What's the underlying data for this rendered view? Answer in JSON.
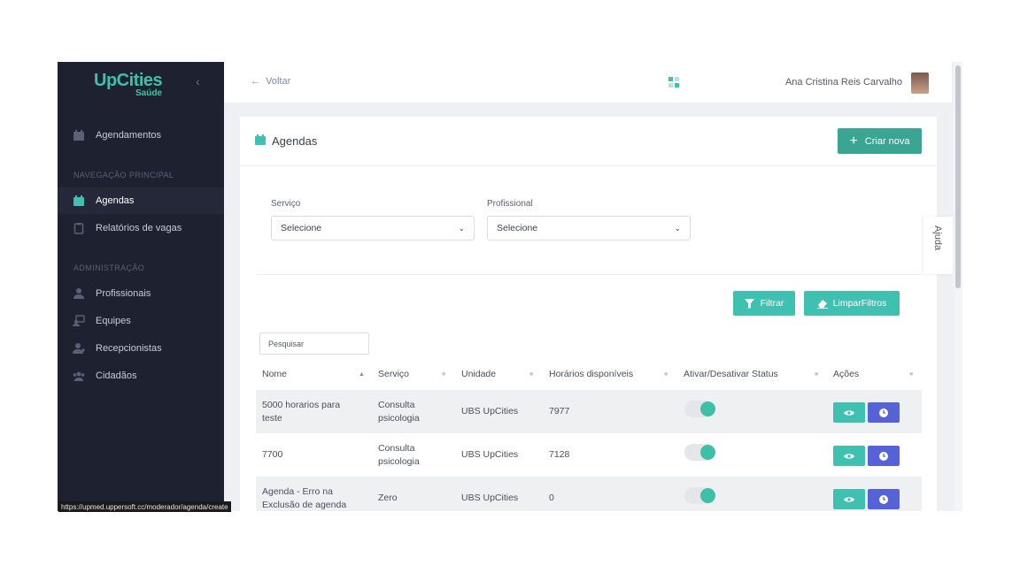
{
  "app": {
    "logo_main": "UpCities",
    "logo_sub": "Saúde"
  },
  "sidebar": {
    "top_item": "Agendamentos",
    "section_main": "NAVEGAÇÃO PRINCIPAL",
    "main_items": [
      "Agendas",
      "Relatórios de vagas"
    ],
    "section_admin": "ADMINISTRAÇÃO",
    "admin_items": [
      "Profissionais",
      "Equipes",
      "Recepcionistas",
      "Cidadãos"
    ]
  },
  "topbar": {
    "back_label": "Voltar",
    "user_name": "Ana Cristina Reis Carvalho"
  },
  "page": {
    "title": "Agendas",
    "new_button": "Criar nova",
    "filters": {
      "service_label": "Serviço",
      "service_value": "Selecione",
      "professional_label": "Profissional",
      "professional_value": "Selecione",
      "filter_button": "Filtrar",
      "clear_button": "LimparFiltros"
    },
    "search_placeholder": "Pesquisar",
    "table": {
      "headers": [
        "Nome",
        "Serviço",
        "Unidade",
        "Horários disponíveis",
        "Ativar/Desativar Status",
        "Ações"
      ],
      "rows": [
        {
          "name_1": "5000 horarios para",
          "name_2": "teste",
          "service_1": "Consulta",
          "service_2": "psicologia",
          "unit": "UBS UpCities",
          "slots": "7977",
          "active": true
        },
        {
          "name_1": "7700",
          "name_2": "",
          "service_1": "Consulta",
          "service_2": "psicologia",
          "unit": "UBS UpCities",
          "slots": "7128",
          "active": true
        },
        {
          "name_1": "Agenda - Erro na",
          "name_2": "Exclusão de agenda",
          "service_1": "Zero",
          "service_2": "",
          "unit": "UBS UpCities",
          "slots": "0",
          "active": true
        }
      ]
    }
  },
  "help_tab": "Ajuda",
  "status_url": "https://upmed.uppersoft.cc/moderador/agenda/create",
  "colors": {
    "primary": "#3aa593",
    "teal": "#3fc0b1",
    "indigo": "#5563d6",
    "sidebar": "#1e2130"
  }
}
